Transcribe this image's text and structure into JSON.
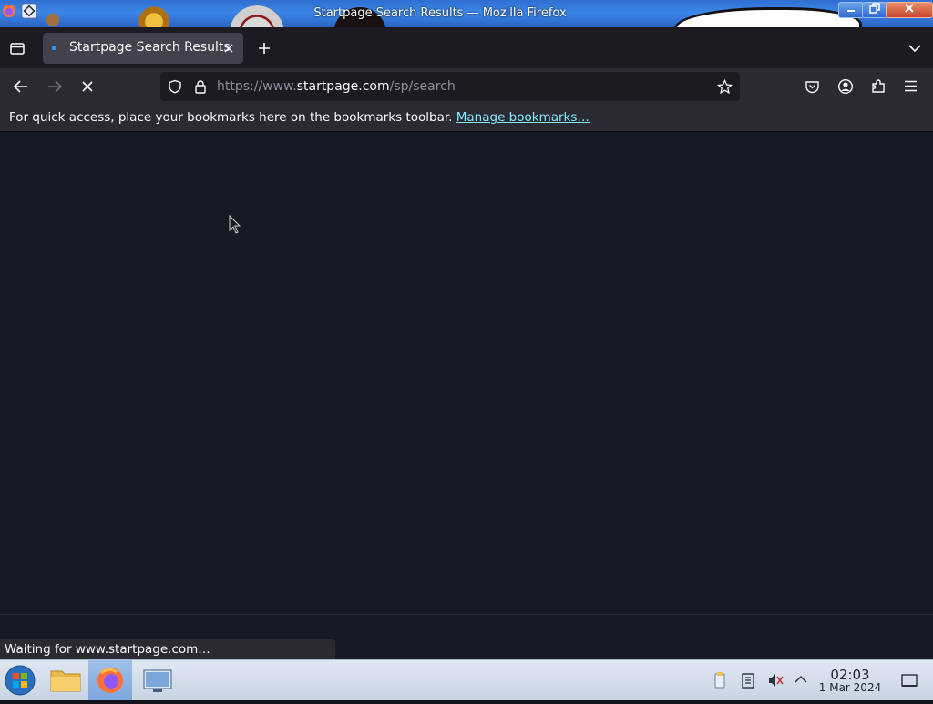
{
  "window": {
    "title": "Startpage Search Results — Mozilla Firefox"
  },
  "tabs": [
    {
      "label": "Startpage Search Results",
      "loading": true
    }
  ],
  "toolbar": {
    "url_prefix": "https://www.",
    "url_host": "startpage.com",
    "url_path": "/sp/search"
  },
  "bookmarks_bar": {
    "message": "For quick access, place your bookmarks here on the bookmarks toolbar.",
    "manage_link": "Manage bookmarks…"
  },
  "status_bar": {
    "text": "Waiting for www.startpage.com…"
  },
  "taskbar": {
    "time": "02:03",
    "date": "1 Mar 2024",
    "apps": [
      "start-menu",
      "file-manager",
      "firefox",
      "remote-desktop"
    ],
    "active_app": "firefox"
  },
  "colors": {
    "accent_link": "#80ebff",
    "tab_bg": "#42414d",
    "toolbar_bg": "#2b2a33",
    "content_bg": "#161a24"
  }
}
